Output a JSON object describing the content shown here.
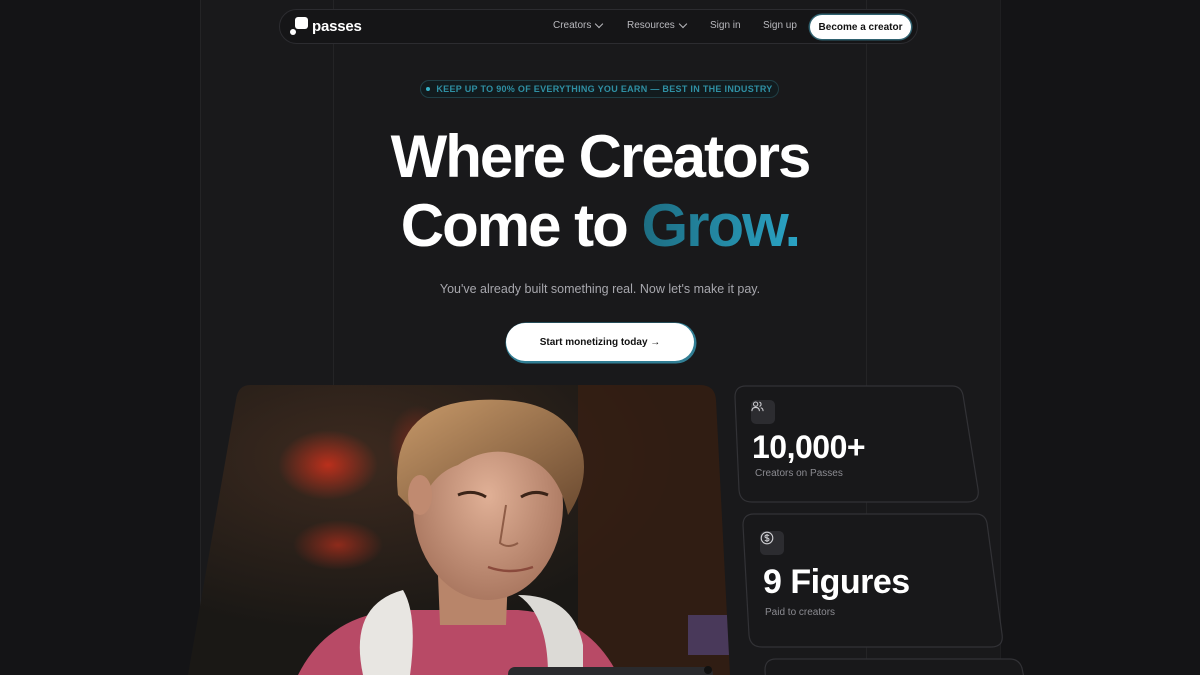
{
  "nav": {
    "logo_text": "passes",
    "items": [
      {
        "label": "Creators",
        "has_dropdown": true
      },
      {
        "label": "Resources",
        "has_dropdown": true
      },
      {
        "label": "Sign in",
        "has_dropdown": false
      },
      {
        "label": "Sign up",
        "has_dropdown": false
      }
    ],
    "cta_label": "Become a creator"
  },
  "badge": {
    "text": "KEEP UP TO 90% OF EVERYTHING YOU EARN — BEST IN THE INDUSTRY"
  },
  "hero": {
    "line1": "Where Creators",
    "line2_prefix": "Come to ",
    "line2_highlight": "Grow.",
    "subtitle": "You've already built something real. Now let's make it pay.",
    "cta_label": "Start monetizing today →"
  },
  "stats": [
    {
      "icon": "users-icon",
      "value": "10,000+",
      "label": "Creators on Passes"
    },
    {
      "icon": "dollar-circle-icon",
      "value": "9 Figures",
      "label": "Paid to creators"
    }
  ],
  "colors": {
    "background": "#19191b",
    "accent": "#2aa3c4",
    "badge_text": "#2f8fa3",
    "button_bg": "#ffffff"
  },
  "image": {
    "subject": "young man with headphones around neck"
  }
}
